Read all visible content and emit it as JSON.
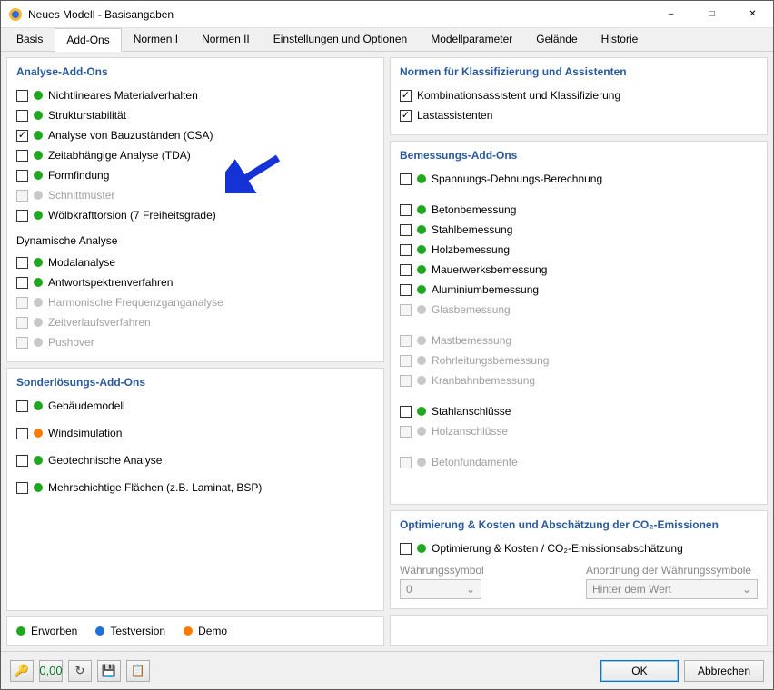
{
  "window": {
    "title": "Neues Modell - Basisangaben"
  },
  "tabs": [
    "Basis",
    "Add-Ons",
    "Normen I",
    "Normen II",
    "Einstellungen und Optionen",
    "Modellparameter",
    "Gelände",
    "Historie"
  ],
  "active_tab": 1,
  "left": {
    "analyse": {
      "title": "Analyse-Add-Ons",
      "items": [
        {
          "label": "Nichtlineares Materialverhalten",
          "dot": "green",
          "checked": false,
          "enabled": true
        },
        {
          "label": "Strukturstabilität",
          "dot": "green",
          "checked": false,
          "enabled": true
        },
        {
          "label": "Analyse von Bauzuständen (CSA)",
          "dot": "green",
          "checked": true,
          "enabled": true
        },
        {
          "label": "Zeitabhängige Analyse (TDA)",
          "dot": "green",
          "checked": false,
          "enabled": true
        },
        {
          "label": "Formfindung",
          "dot": "green",
          "checked": false,
          "enabled": true
        },
        {
          "label": "Schnittmuster",
          "dot": "gray",
          "checked": false,
          "enabled": false
        },
        {
          "label": "Wölbkrafttorsion (7 Freiheitsgrade)",
          "dot": "green",
          "checked": false,
          "enabled": true
        }
      ],
      "dyn_title": "Dynamische Analyse",
      "dyn_items": [
        {
          "label": "Modalanalyse",
          "dot": "green",
          "checked": false,
          "enabled": true
        },
        {
          "label": "Antwortspektrenverfahren",
          "dot": "green",
          "checked": false,
          "enabled": true
        },
        {
          "label": "Harmonische Frequenzganganalyse",
          "dot": "gray",
          "checked": false,
          "enabled": false
        },
        {
          "label": "Zeitverlaufsverfahren",
          "dot": "gray",
          "checked": false,
          "enabled": false
        },
        {
          "label": "Pushover",
          "dot": "gray",
          "checked": false,
          "enabled": false
        }
      ]
    },
    "sonder": {
      "title": "Sonderlösungs-Add-Ons",
      "items": [
        {
          "label": "Gebäudemodell",
          "dot": "green",
          "checked": false,
          "enabled": true
        },
        {
          "label": "Windsimulation",
          "dot": "orange",
          "checked": false,
          "enabled": true
        },
        {
          "label": "Geotechnische Analyse",
          "dot": "green",
          "checked": false,
          "enabled": true
        },
        {
          "label": "Mehrschichtige Flächen (z.B. Laminat, BSP)",
          "dot": "green",
          "checked": false,
          "enabled": true
        }
      ]
    },
    "legend": {
      "erworben": "Erworben",
      "testversion": "Testversion",
      "demo": "Demo"
    }
  },
  "right": {
    "normen": {
      "title": "Normen für Klassifizierung und Assistenten",
      "items": [
        {
          "label": "Kombinationsassistent und Klassifizierung",
          "checked": true
        },
        {
          "label": "Lastassistenten",
          "checked": true
        }
      ]
    },
    "bemessung": {
      "title": "Bemessungs-Add-Ons",
      "groups": [
        [
          {
            "label": "Spannungs-Dehnungs-Berechnung",
            "dot": "green",
            "checked": false,
            "enabled": true
          }
        ],
        [
          {
            "label": "Betonbemessung",
            "dot": "green",
            "checked": false,
            "enabled": true
          },
          {
            "label": "Stahlbemessung",
            "dot": "green",
            "checked": false,
            "enabled": true
          },
          {
            "label": "Holzbemessung",
            "dot": "green",
            "checked": false,
            "enabled": true
          },
          {
            "label": "Mauerwerksbemessung",
            "dot": "green",
            "checked": false,
            "enabled": true
          },
          {
            "label": "Aluminiumbemessung",
            "dot": "green",
            "checked": false,
            "enabled": true
          },
          {
            "label": "Glasbemessung",
            "dot": "gray",
            "checked": false,
            "enabled": false
          }
        ],
        [
          {
            "label": "Mastbemessung",
            "dot": "gray",
            "checked": false,
            "enabled": false
          },
          {
            "label": "Rohrleitungsbemessung",
            "dot": "gray",
            "checked": false,
            "enabled": false
          },
          {
            "label": "Kranbahnbemessung",
            "dot": "gray",
            "checked": false,
            "enabled": false
          }
        ],
        [
          {
            "label": "Stahlanschlüsse",
            "dot": "green",
            "checked": false,
            "enabled": true
          },
          {
            "label": "Holzanschlüsse",
            "dot": "gray",
            "checked": false,
            "enabled": false
          }
        ],
        [
          {
            "label": "Betonfundamente",
            "dot": "gray",
            "checked": false,
            "enabled": false
          }
        ]
      ]
    },
    "opt": {
      "title": "Optimierung & Kosten und Abschätzung der CO₂-Emissionen",
      "item": {
        "label": "Optimierung & Kosten / CO₂-Emissionsabschätzung",
        "dot": "green",
        "checked": false,
        "enabled": true
      },
      "currency_label": "Währungssymbol",
      "currency_value": "0",
      "arrangement_label": "Anordnung der Währungssymbole",
      "arrangement_value": "Hinter dem Wert"
    }
  },
  "footer": {
    "ok": "OK",
    "cancel": "Abbrechen"
  }
}
